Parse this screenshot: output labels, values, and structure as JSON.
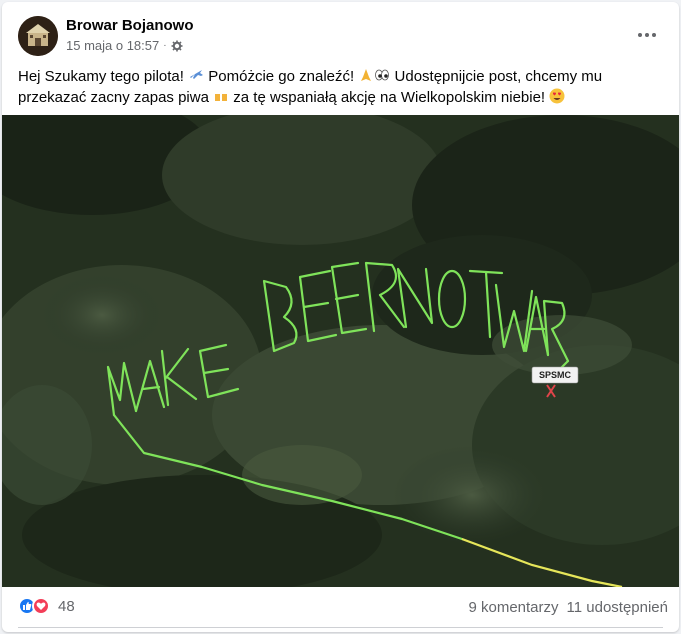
{
  "post": {
    "author": "Browar Bojanowo",
    "timestamp": "15 maja o 18:57",
    "audience_icon": "gear-icon",
    "caption_parts": {
      "p1": "Hej Szukamy tego pilota!",
      "p2": "Pomóżcie go znaleźć!",
      "p3": "Udostępnijcie post, chcemy mu przekazać zacny zapas piwa",
      "p4": "za tę wspaniałą akcję na Wielkopolskim niebie!"
    },
    "emoji": [
      "airplane",
      "praying-hands",
      "eyes",
      "beer-mugs",
      "heart-eyes"
    ]
  },
  "photo": {
    "flight_label": "SPSMC",
    "skywriting": "MAKE BEER NOT WAR"
  },
  "footer": {
    "reaction_count": "48",
    "comments": "9 komentarzy",
    "shares": "11 udostępnień"
  },
  "colors": {
    "track_green": "#7fe35a",
    "track_yellow": "#e6e65a",
    "like_blue": "#1877f2",
    "love_red": "#f33e58"
  }
}
